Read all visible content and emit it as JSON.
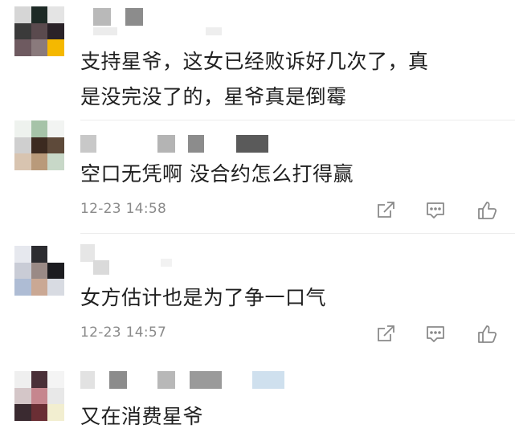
{
  "comments": [
    {
      "text_line1": "支持星爷，这女已经败诉好几次了，真",
      "text_line2": "是没完没了的，星爷真是倒霉"
    },
    {
      "text_line1": "空口无凭啊  没合约怎么打得赢",
      "timestamp": "12-23 14:58"
    },
    {
      "text_line1": "女方估计也是为了争一口气",
      "timestamp": "12-23 14:57"
    },
    {
      "text_line1": "又在消费星爷"
    }
  ],
  "icons": {
    "share": "share-icon",
    "reply": "comment-icon",
    "like": "thumbs-up-icon"
  },
  "colors": {
    "text": "#1f1f1f",
    "meta": "#8a8a8a",
    "icon": "#8a8a8a"
  }
}
